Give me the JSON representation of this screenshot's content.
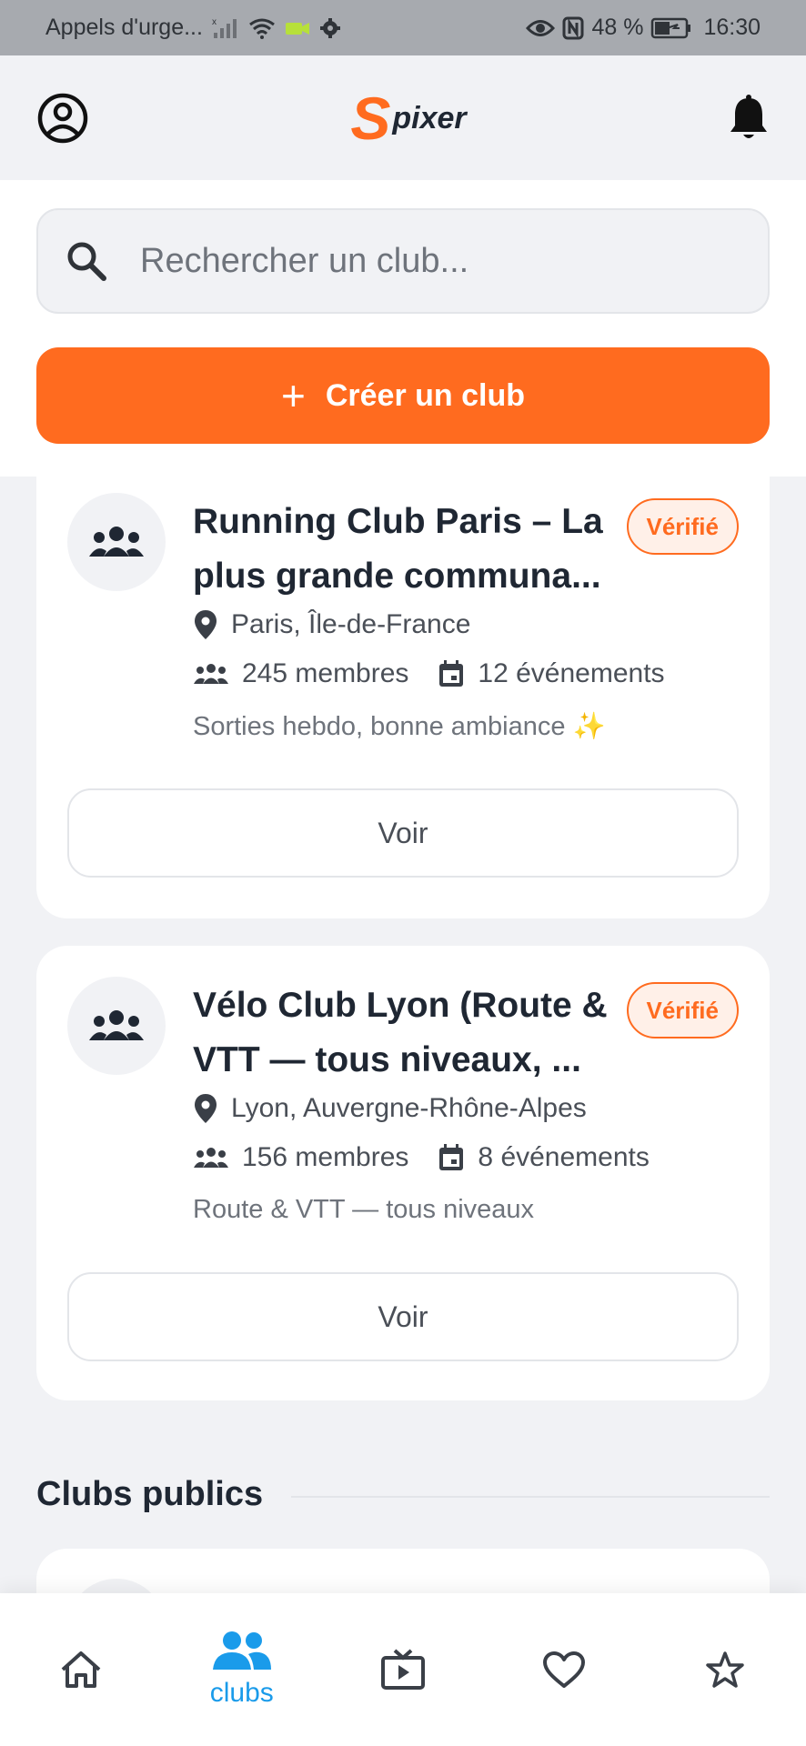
{
  "status_bar": {
    "carrier": "Appels d'urge...",
    "battery": "48 %",
    "time": "16:30"
  },
  "header": {
    "logo_s": "S",
    "logo_text": "pixer"
  },
  "search": {
    "placeholder": "Rechercher un club..."
  },
  "create_button": {
    "icon": "+",
    "label": "Créer un club"
  },
  "clubs": [
    {
      "title": "Running Club Paris – La plus grande communa...",
      "badge": "Vérifié",
      "location": "Paris, Île-de-France",
      "members": "245 membres",
      "events": "12 événements",
      "description": "Sorties hebdo, bonne ambiance ✨",
      "button": "Voir"
    },
    {
      "title": "Vélo Club Lyon (Route & VTT — tous niveaux, ...",
      "badge": "Vérifié",
      "location": "Lyon, Auvergne-Rhône-Alpes",
      "members": "156 membres",
      "events": "8 événements",
      "description": "Route & VTT — tous niveaux",
      "button": "Voir"
    }
  ],
  "sections": {
    "public_clubs": "Clubs publics"
  },
  "bottom_nav": {
    "items": [
      {
        "icon": "home-icon",
        "label": ""
      },
      {
        "icon": "group-icon",
        "label": "clubs",
        "active": true
      },
      {
        "icon": "tv-icon",
        "label": ""
      },
      {
        "icon": "heart-icon",
        "label": ""
      },
      {
        "icon": "star-icon",
        "label": ""
      }
    ]
  },
  "colors": {
    "accent": "#ff6b1f",
    "active_nav": "#1a9bea",
    "text_dark": "#1f2733",
    "text_muted": "#6e737b",
    "background": "#f1f2f5"
  }
}
